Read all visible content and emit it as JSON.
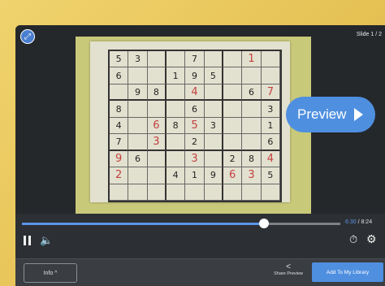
{
  "player": {
    "slide_counter": "Slide 1 / 2",
    "preview_label": "Preview",
    "progress": {
      "fraction": 0.76,
      "current": "6:30",
      "separator": " / ",
      "total": "8:24"
    },
    "info_label": "Info ^",
    "share_label": "Share Preview",
    "library_label": "Add To My Library"
  },
  "sudoku": [
    [
      "5",
      "3",
      "",
      "",
      "7",
      "",
      "",
      "1",
      ""
    ],
    [
      "6",
      "",
      "",
      "1",
      "9",
      "5",
      "",
      "",
      ""
    ],
    [
      "",
      "9",
      "8",
      "",
      "4",
      "",
      "",
      "6",
      "7"
    ],
    [
      "8",
      "",
      "",
      "",
      "6",
      "",
      "",
      "",
      "3"
    ],
    [
      "4",
      "",
      "6",
      "8",
      "5",
      "3",
      "",
      "",
      "1"
    ],
    [
      "7",
      "",
      "3",
      "",
      "2",
      "",
      "",
      "",
      "6"
    ],
    [
      "9",
      "6",
      "",
      "",
      "3",
      "",
      "2",
      "8",
      "4"
    ],
    [
      "2",
      "",
      "",
      "4",
      "1",
      "9",
      "6",
      "3",
      "5"
    ],
    [
      "",
      "",
      "",
      "",
      "",
      "",
      "",
      "",
      ""
    ]
  ],
  "sudoku_red": [
    [
      0,
      0,
      0,
      0,
      0,
      0,
      0,
      1,
      0
    ],
    [
      0,
      0,
      0,
      0,
      0,
      0,
      0,
      0,
      0
    ],
    [
      0,
      0,
      0,
      0,
      1,
      0,
      0,
      0,
      1
    ],
    [
      0,
      0,
      0,
      0,
      0,
      0,
      0,
      0,
      0
    ],
    [
      0,
      0,
      1,
      0,
      1,
      0,
      0,
      0,
      0
    ],
    [
      0,
      0,
      1,
      0,
      0,
      0,
      0,
      0,
      0
    ],
    [
      1,
      0,
      0,
      0,
      1,
      0,
      0,
      0,
      1
    ],
    [
      1,
      0,
      0,
      0,
      0,
      0,
      1,
      1,
      0
    ],
    [
      0,
      0,
      0,
      0,
      0,
      0,
      0,
      0,
      0
    ]
  ],
  "colors": {
    "accent": "#4f8fe0",
    "frame": "#e6c255",
    "player_bg": "#2c2f33"
  },
  "icons": [
    "expand-icon",
    "pause-icon",
    "volume-icon",
    "timer-icon",
    "gear-icon",
    "share-icon",
    "play-triangle-icon"
  ]
}
